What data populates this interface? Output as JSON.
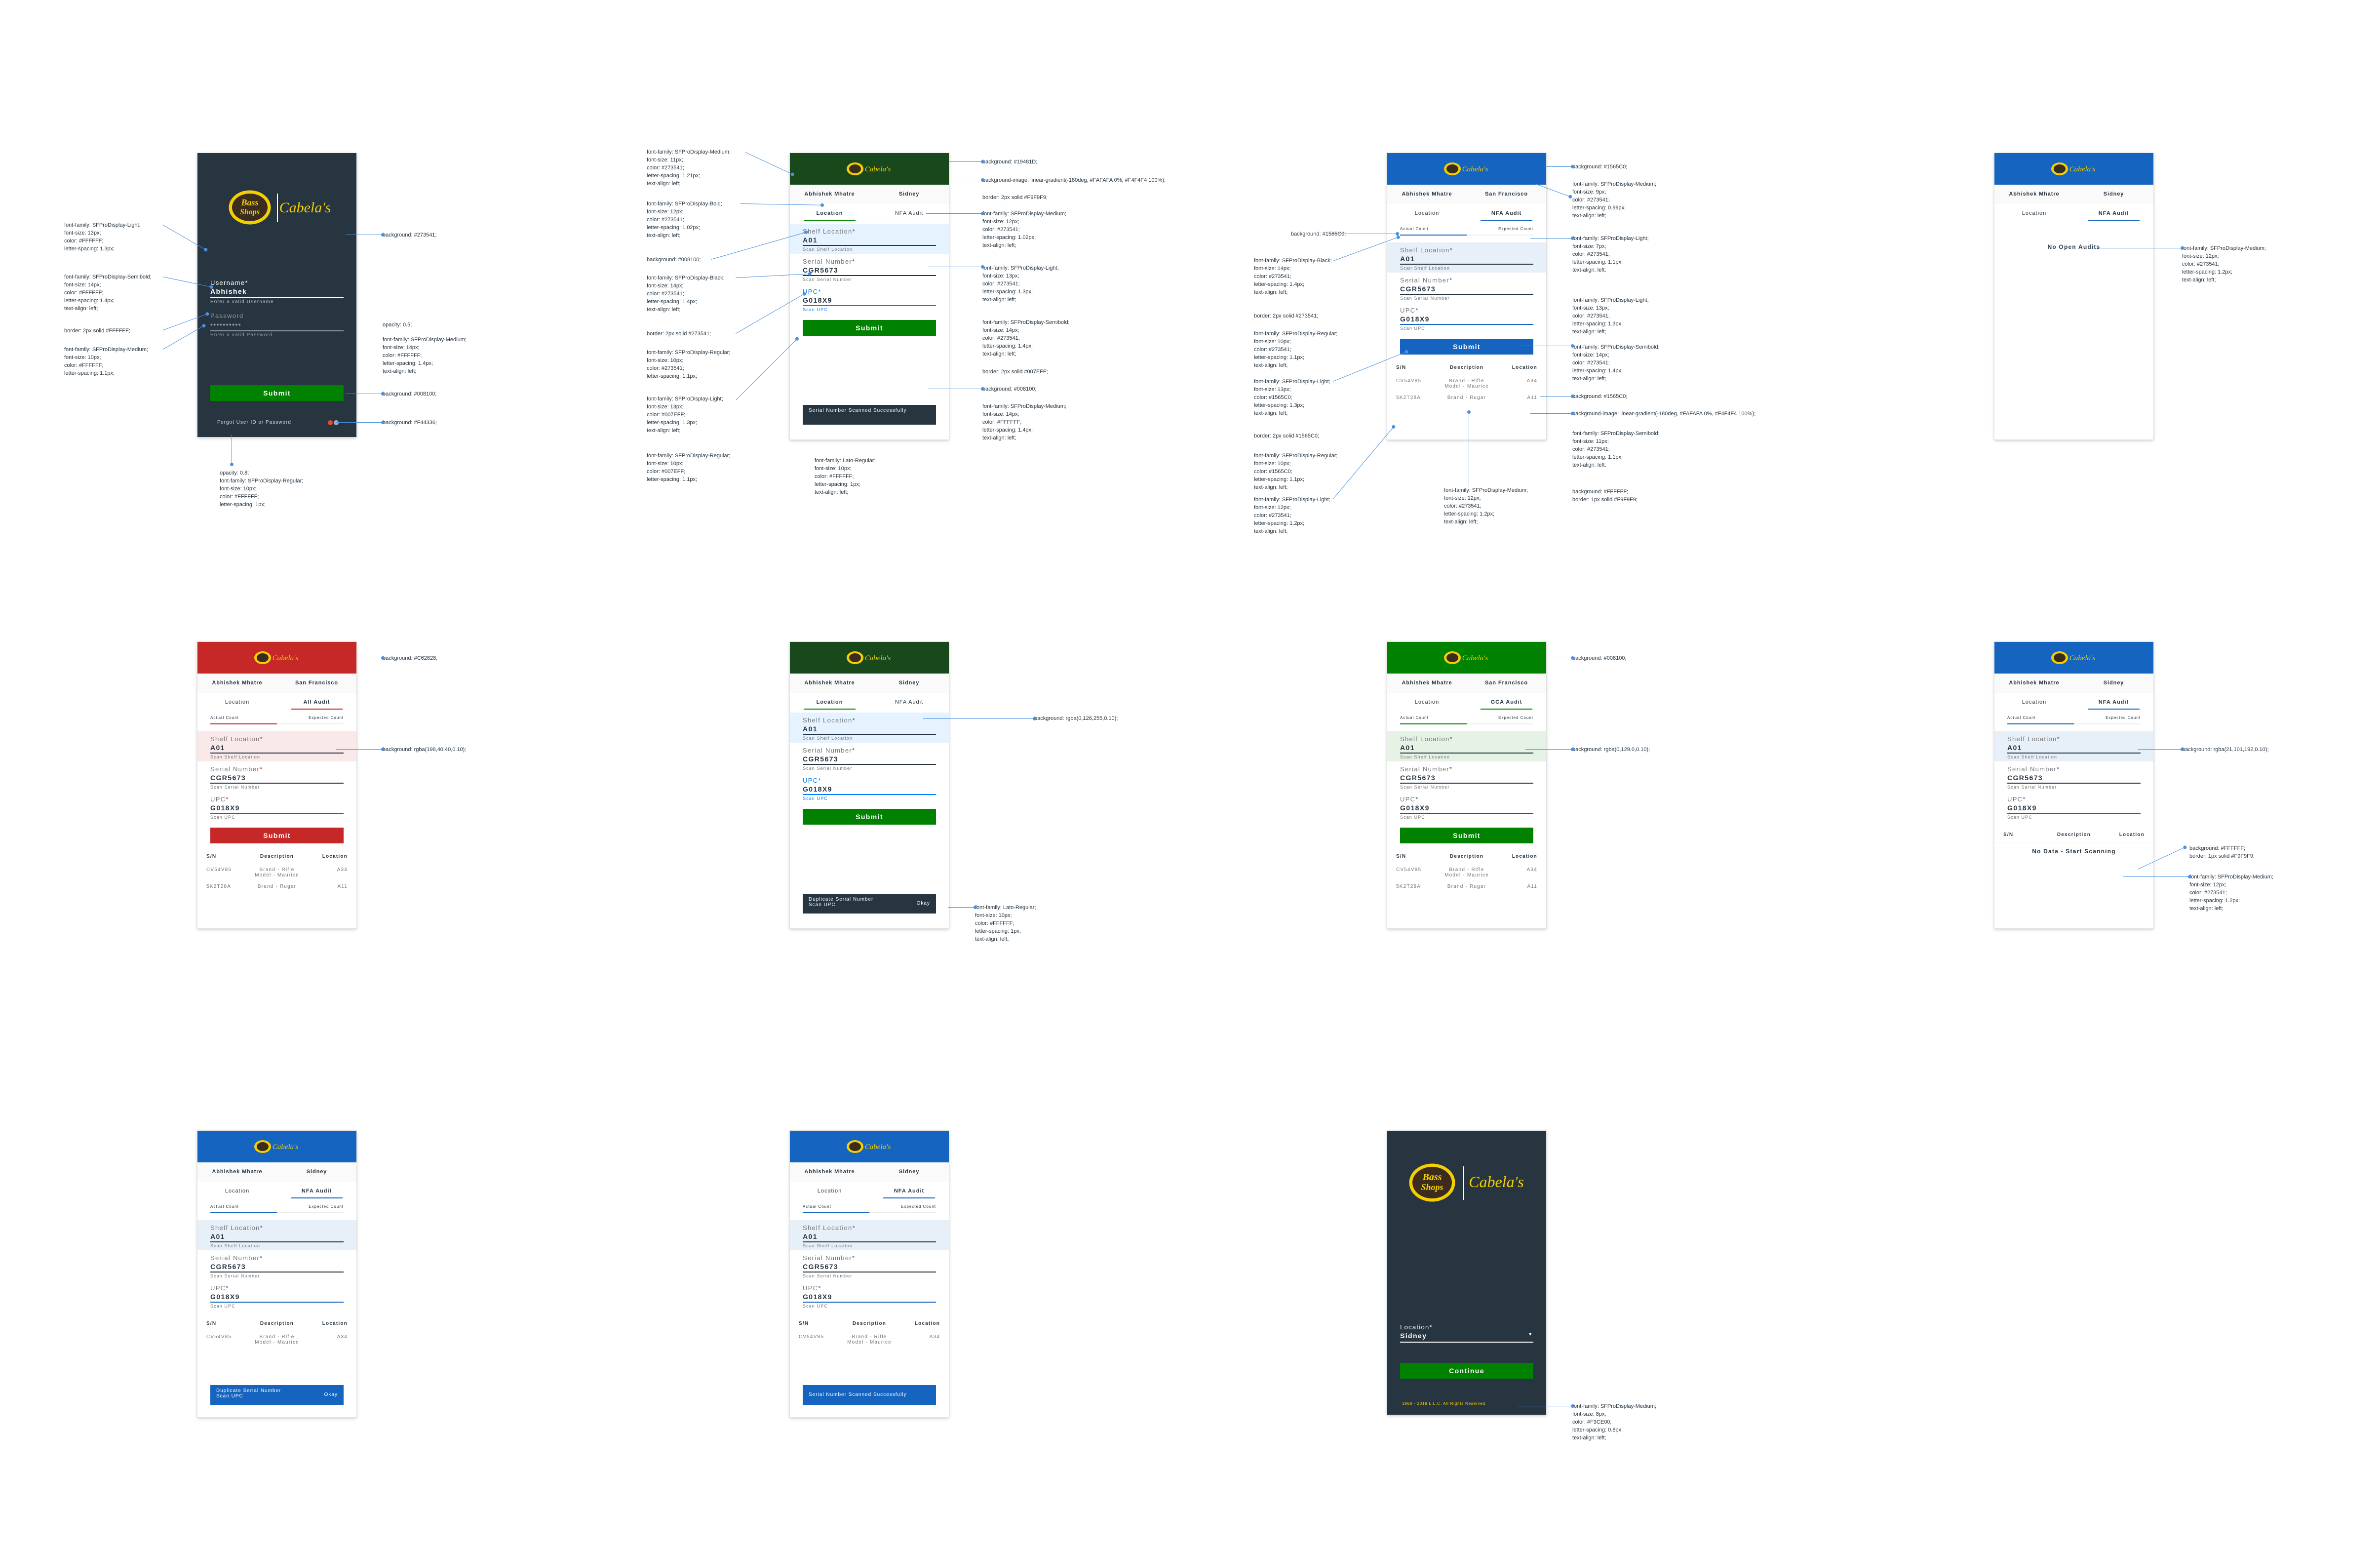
{
  "colors": {
    "navy": "#273541",
    "green": "#008100",
    "dark_green": "#19481D",
    "blue": "#1565C0",
    "red": "#C62828",
    "orange": "#F44336",
    "gold": "#F3CE00",
    "toast_dark": "#273541"
  },
  "brand": {
    "bass_pro": "Bass Pro Shops",
    "cabelas": "Cabela's"
  },
  "login": {
    "username_label": "Username",
    "username_value": "Abhishek",
    "username_helper": "Enter a valid Username",
    "password_label": "Password",
    "password_value": "••••••••••",
    "password_helper": "Enter a valid Password",
    "submit": "Submit",
    "forgot": "Forgot User ID or Password"
  },
  "users": {
    "name": "Abhishek Mhatre",
    "city_sf": "San Francisco",
    "city_sydney": "Sidney"
  },
  "tabs": {
    "location": "Location",
    "nfa": "NFA Audit",
    "all": "All Audit",
    "gca": "GCA Audit"
  },
  "counts": {
    "actual": "Actual Count",
    "expected": "Expected Count"
  },
  "form": {
    "shelf_label": "Shelf Location",
    "shelf_value": "A01",
    "shelf_helper": "Scan Shelf Location",
    "serial_label": "Serial Number",
    "serial_value": "CGR5673",
    "serial_helper": "Scan Serial Number",
    "upc_label": "UPC",
    "upc_value": "G018X9",
    "upc_helper": "Scan UPC",
    "required": "*",
    "submit": "Submit"
  },
  "table": {
    "headers": [
      "S/N",
      "Description",
      "Location"
    ],
    "rows": [
      [
        "CV54V85",
        "Brand - Rifle Model - Maurice",
        "A34"
      ],
      [
        "5K2T28A",
        "Brand - Rugar",
        "A11"
      ]
    ]
  },
  "toasts": {
    "success": "Serial Number Scanned Successfully",
    "duplicate_line1": "Duplicate Serial Number",
    "duplicate_line2": "Scan UPC",
    "okay": "Okay"
  },
  "empty": {
    "no_open": "No Open Audits",
    "no_data": "No Data - Start Scanning"
  },
  "location_screen": {
    "label": "Location",
    "value": "Sidney",
    "button": "Continue",
    "copyright": "1969 - 2018 L.L.C. All Rights Reserved"
  },
  "notes": {
    "login_title": "font-family: SFProDisplay-Light;\nfont-size: 13px;\ncolor: #FFFFFF;\nletter-spacing: 1.3px;",
    "login_value": "font-family: SFProDisplay-Semibold;\nfont-size: 14px;\ncolor: #FFFFFF;\nletter-spacing: 1.4px;\ntext-align: left;",
    "login_border": "border: 2px solid #FFFFFF;",
    "login_helper": "font-family: SFProDisplay-Medium;\nfont-size: 10px;\ncolor: #FFFFFF;\nletter-spacing: 1.1px;",
    "login_bg": "background: #273541;",
    "login_opacity": "opacity: 0.5;",
    "login_btn_font": "font-family: SFProDisplay-Medium;\nfont-size: 14px;\ncolor: #FFFFFF;\nletter-spacing: 1.4px;\ntext-align: left;",
    "login_btn_bg": "background: #008100;",
    "login_dot": "background: #F44336;",
    "login_forgot": "opacity: 0.8;\nfont-family: SFProDisplay-Regular;\nfont-size: 10px;\ncolor: #FFFFFF;\nletter-spacing: 1px;",
    "s2_names": "font-family: SFProDisplay-Medium;\nfont-size: 11px;\ncolor: #273541;\nletter-spacing: 1.21px;\ntext-align: left;",
    "s2_bg": "background: #19481D;",
    "s2_gradient": "background-image: linear-gradient(-180deg, #FAFAFA 0%, #F4F4F4 100%);",
    "s2_border": "border: 2px solid #F9F9F9;",
    "s2_tab_bold": "font-family: SFProDisplay-Bold;\nfont-size: 12px;\ncolor: #273541;\nletter-spacing: 1.02px;\ntext-align: left;",
    "s2_tab_med": "font-family: SFProDisplay-Medium;\nfont-size: 12px;\ncolor: #273541;\nletter-spacing: 1.02px;\ntext-align: left;",
    "s2_underline": "background: #008100;",
    "s2_value_black": "font-family: SFProDisplay-Black;\nfont-size: 14px;\ncolor: #273541;\nletter-spacing: 1.4px;\ntext-align: left;",
    "s2_label_light": "font-family: SFProDisplay-Light;\nfont-size: 13px;\ncolor: #273541;\nletter-spacing: 1.3px;\ntext-align: left;",
    "s2_border_navy": "border: 2px solid #273541;",
    "s2_semibold": "font-family: SFProDisplay-Semibold;\nfont-size: 14px;\ncolor: #273541;\nletter-spacing: 1.4px;\ntext-align: left;",
    "s2_helper": "font-family: SFProDisplay-Regular;\nfont-size: 10px;\ncolor: #273541;\nletter-spacing: 1.1px;",
    "s2_border_blue": "border: 2px solid #007EFF;",
    "s2_upc_label": "font-family: SFProDisplay-Light;\nfont-size: 13px;\ncolor: #007EFF;\nletter-spacing: 1.3px;\ntext-align: left;",
    "s2_btn_bg": "background: #008100;",
    "s2_btn_font": "font-family: SFProDisplay-Medium;\nfont-size: 14px;\ncolor: #FFFFFF;\nletter-spacing: 1.4px;\ntext-align: left;",
    "s2_upc_helper": "font-family: SFProDisplay-Regular;\nfont-size: 10px;\ncolor: #007EFF;\nletter-spacing: 1.1px;",
    "s2_toast": "font-family: Lato-Regular;\nfont-size: 10px;\ncolor: #FFFFFF;\nletter-spacing: 1px;\ntext-align: left;",
    "s3_bg": "background: #1565C0;",
    "s3_tab_med": "font-family: SFProDisplay-Medium;\nfont-size: 9px;\ncolor: #273541;\nletter-spacing: 0.99px;\ntext-align: left;",
    "s3_count_light": "font-family: SFProDisplay-Light;\nfont-size: 7px;\ncolor: #273541;\nletter-spacing: 1.1px;\ntext-align: left;",
    "s3_value_black": "font-family: SFProDisplay-Black;\nfont-size: 14px;\ncolor: #273541;\nletter-spacing: 1.4px;\ntext-align: left;",
    "s3_label_light": "font-family: SFProDisplay-Light;\nfont-size: 13px;\ncolor: #273541;\nletter-spacing: 1.3px;\ntext-align: left;",
    "s3_border": "border: 2px solid #273541;",
    "s3_helper": "font-family: SFProDisplay-Regular;\nfont-size: 10px;\ncolor: #273541;\nletter-spacing: 1.1px;\ntext-align: left;",
    "s3_upc_light": "font-family: SFProDisplay-Light;\nfont-size: 13px;\ncolor: #1565C0;\nletter-spacing: 1.3px;\ntext-align: left;",
    "s3_border_blue": "border: 2px solid #1565C0;",
    "s3_upc_helper": "font-family: SFProDisplay-Regular;\nfont-size: 10px;\ncolor: #1565C0;\nletter-spacing: 1.1px;\ntext-align: left;",
    "s3_tbl_light": "font-family: SFProDisplay-Light;\nfont-size: 12px;\ncolor: #273541;\nletter-spacing: 1.2px;\ntext-align: left;",
    "s3_semibold_blue": "font-family: SFProDisplay-Semibold;\nfont-size: 14px;\ncolor: #273541;\nletter-spacing: 1.4px;\ntext-align: left;",
    "s3_gradient": "background-image: linear-gradient(-180deg, #FAFAFA 0%, #F4F4F4 100%);",
    "s3_btn_bg": "background: #1565C0;",
    "s3_tbl_semibold": "font-family: SFProDisplay-Semibold;\nfont-size: 11px;\ncolor: #273541;\nletter-spacing: 1.1px;\ntext-align: left;",
    "s3_row_bg": "background: #FFFFFF;\nborder: 1px solid #F9F9F9;",
    "s3_desc_med": "font-family: SFProDisplay-Medium;\nfont-size: 12px;\ncolor: #273541;\nletter-spacing: 1.2px;\ntext-align: left;",
    "s4_empty": "font-family: SFProDisplay-Medium;\nfont-size: 12px;\ncolor: #273541;\nletter-spacing: 1.2px;\ntext-align: left;",
    "s5_bg": "background: #C62828;",
    "s5_hl": "background: rgba(198,40,40,0.10);",
    "s6_hl": "background: rgba(0,126,255,0.10);",
    "s6_toast": "font-family: Lato-Regular;\nfont-size: 10px;\ncolor: #FFFFFF;\nletter-spacing: 1px;\ntext-align: left;",
    "s7_bg": "background: #008100;",
    "s7_hl": "background: rgba(0,129,0,0.10);",
    "s8_hl": "background: rgba(21,101,192,0.10);",
    "s8_row": "background: #FFFFFF;\nborder: 1px solid #F9F9F9;",
    "s8_empty": "font-family: SFProDisplay-Medium;\nfont-size: 12px;\ncolor: #273541;\nletter-spacing: 1.2px;\ntext-align: left;",
    "s11_copy": "font-family: SFProDisplay-Medium;\nfont-size: 8px;\ncolor: #F3CE00;\nletter-spacing: 0.8px;\ntext-align: left;"
  }
}
